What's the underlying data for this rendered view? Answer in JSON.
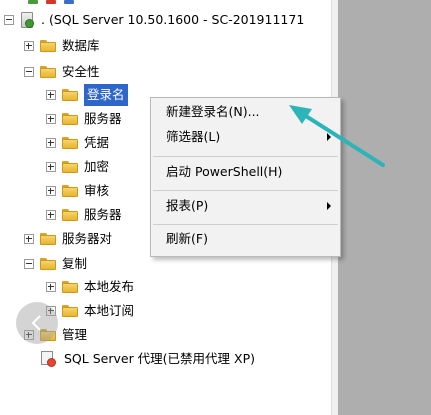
{
  "tree": {
    "server_label": ". (SQL Server 10.50.1600 - SC-201911171",
    "databases": "数据库",
    "security": "安全性",
    "security_children": [
      "登录名",
      "服务器",
      "凭据",
      "加密",
      "审核",
      "服务器"
    ],
    "server_objects": "服务器对",
    "replication": "复制",
    "replication_children": [
      "本地发布",
      "本地订阅"
    ],
    "management": "管理",
    "agent": "SQL Server 代理(已禁用代理 XP)"
  },
  "context_menu": {
    "new_login": "新建登录名(N)...",
    "filter": "筛选器(L)",
    "start_powershell": "启动 PowerShell(H)",
    "reports": "报表(P)",
    "refresh": "刷新(F)"
  },
  "colors": {
    "selection": "#2f66c9",
    "annotation_arrow": "#2bb5b8",
    "menu_background": "#f2f2f2"
  },
  "icons": {
    "folder": "folder-icon",
    "server": "server-icon",
    "agent": "agent-disabled-icon",
    "nav": "chevron-left-icon"
  }
}
